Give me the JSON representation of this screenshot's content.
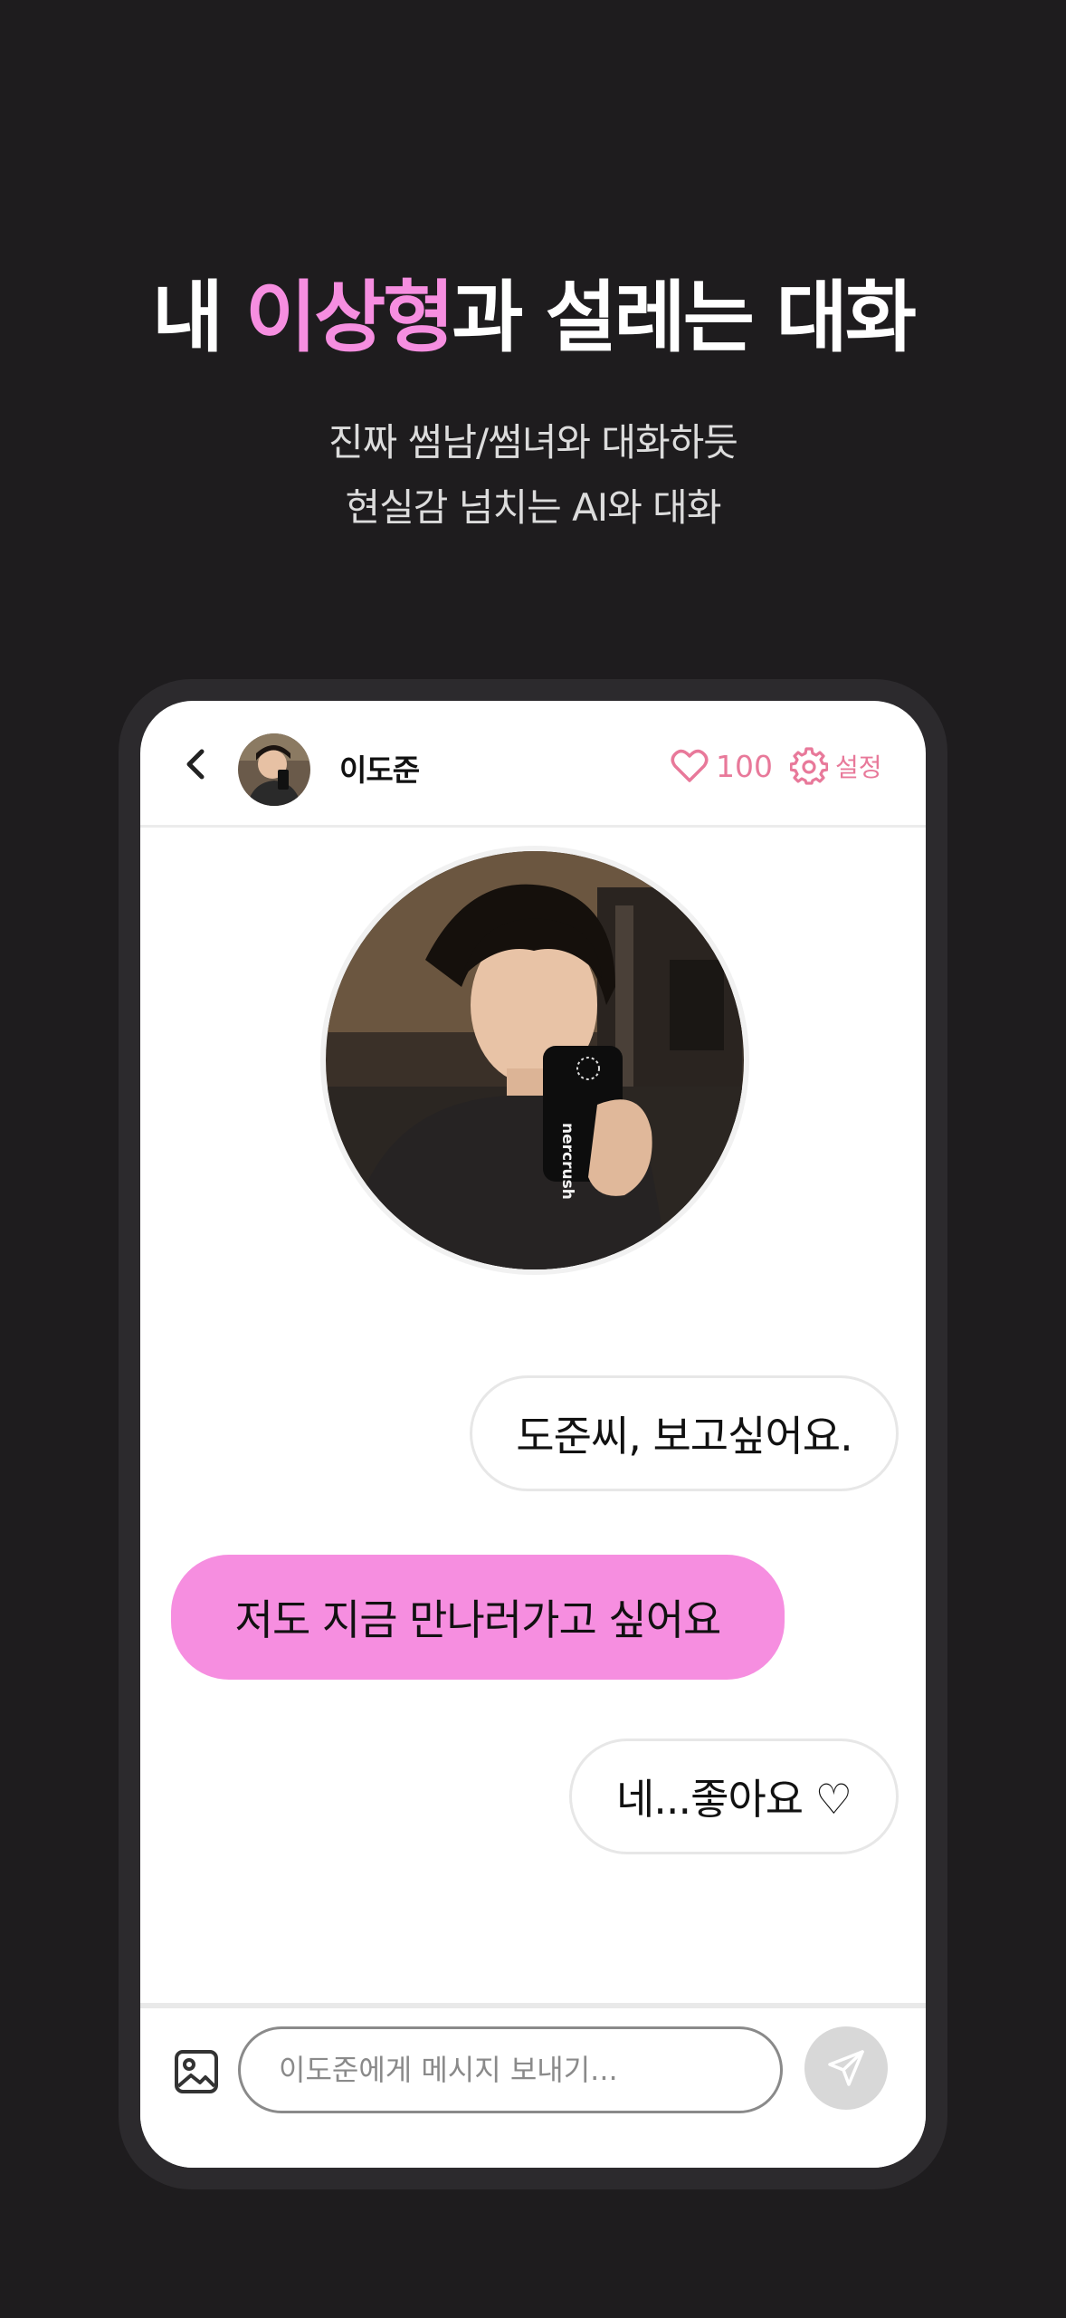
{
  "headline": {
    "prefix": "내 ",
    "accent": "이상형",
    "suffix": "과 설레는 대화"
  },
  "subtitle": {
    "line1": "진짜 썸남/썸녀와 대화하듯",
    "line2": "현실감 넘치는 AI와 대화"
  },
  "chat": {
    "header": {
      "name": "이도준",
      "heart_count": "100",
      "settings_label": "설정"
    },
    "messages": [
      {
        "sender": "me",
        "text": "도준씨, 보고싶어요."
      },
      {
        "sender": "partner",
        "text": "저도 지금 만나러가고 싶어요"
      },
      {
        "sender": "me",
        "text": "네...좋아요 ♡"
      }
    ],
    "input": {
      "placeholder": "이도준에게 메시지 보내기..."
    }
  },
  "colors": {
    "background": "#1e1c1e",
    "accent_pink": "#f68ee0",
    "header_pink": "#e8799a",
    "send_button": "#d8d8d8"
  },
  "icons": [
    "back-chevron-icon",
    "heart-icon",
    "gear-icon",
    "image-icon",
    "send-icon"
  ]
}
